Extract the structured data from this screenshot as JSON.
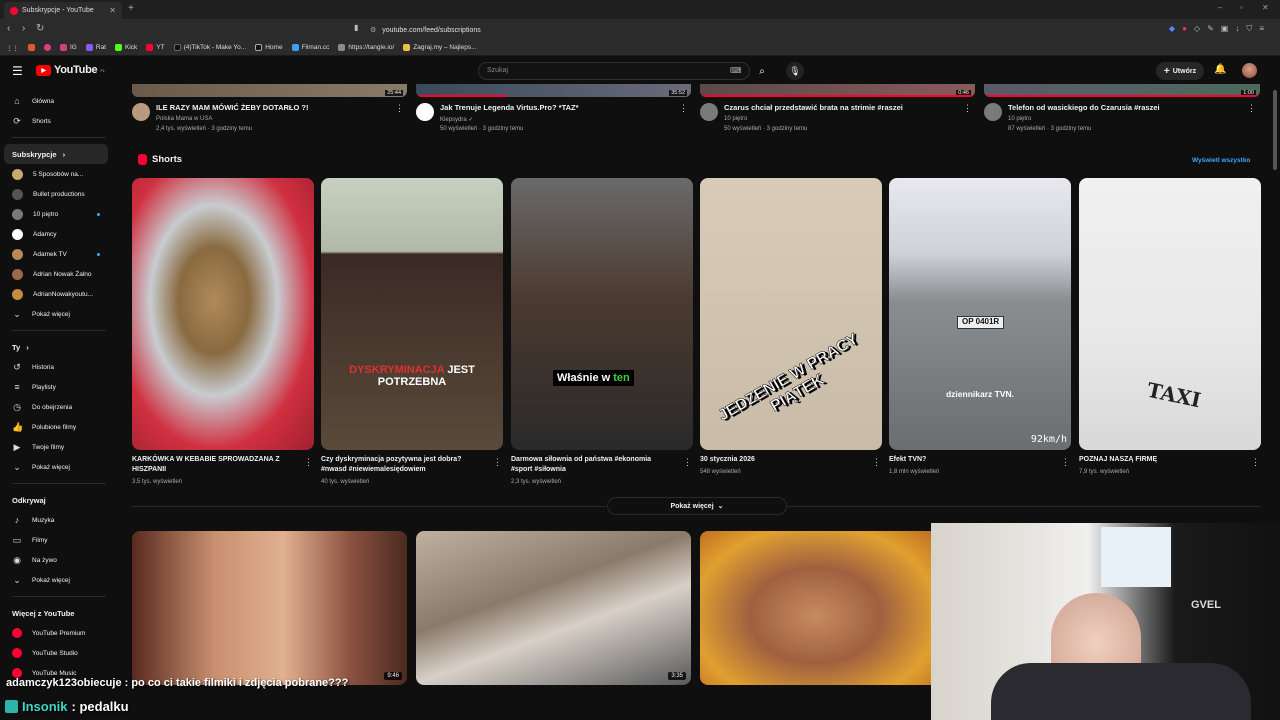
{
  "browser": {
    "tab_title": "Subskrypcje - YouTube",
    "url": "youtube.com/feed/subscriptions",
    "bookmarks": [
      "IG",
      "Rat",
      "Kick",
      "YT",
      "(4)TikTok - Make Yo...",
      "Home",
      "Filman.cc",
      "https://tangle.io/",
      "Zagraj.my – Najleps..."
    ]
  },
  "header": {
    "logo": "YouTube",
    "logo_country": "PL",
    "search_placeholder": "Szukaj",
    "create_label": "Utwórz"
  },
  "sidebar": {
    "main": [
      {
        "label": "Główna",
        "icon": "home-icon",
        "glyph": "⌂"
      },
      {
        "label": "Shorts",
        "icon": "shorts-icon",
        "glyph": "⟳"
      }
    ],
    "subs_title": "Subskrypcje",
    "subs_chevron": "›",
    "subs": [
      {
        "label": "5 Sposobów na...",
        "color": "#c9a770",
        "dot": false
      },
      {
        "label": "Bullet productions",
        "color": "#555555",
        "dot": false
      },
      {
        "label": "10 piętro",
        "color": "#7a7a7a",
        "dot": true
      },
      {
        "label": "Adamcy",
        "color": "#ffffff",
        "dot": false
      },
      {
        "label": "Adamek TV",
        "color": "#b88a5a",
        "dot": true
      },
      {
        "label": "Adrian Nowak Żalno",
        "color": "#9a6a4a",
        "dot": false
      },
      {
        "label": "AdrianNowakyoutu...",
        "color": "#c68a40",
        "dot": false
      }
    ],
    "subs_more": "Pokaż więcej",
    "you_title": "Ty",
    "you_chevron": "›",
    "you": [
      {
        "label": "Historia",
        "icon": "history-icon",
        "glyph": "↺"
      },
      {
        "label": "Playlisty",
        "icon": "playlist-icon",
        "glyph": "≡"
      },
      {
        "label": "Do obejrzenia",
        "icon": "watch-later-icon",
        "glyph": "◷"
      },
      {
        "label": "Polubione filmy",
        "icon": "like-icon",
        "glyph": "👍"
      },
      {
        "label": "Twoje filmy",
        "icon": "your-videos-icon",
        "glyph": "▶"
      },
      {
        "label": "Pokaż więcej",
        "icon": "chevron-down-icon",
        "glyph": "⌄"
      }
    ],
    "explore_title": "Odkrywaj",
    "explore": [
      {
        "label": "Muzyka",
        "icon": "music-icon",
        "glyph": "♪"
      },
      {
        "label": "Filmy",
        "icon": "film-icon",
        "glyph": "▭"
      },
      {
        "label": "Na żywo",
        "icon": "live-icon",
        "glyph": "◉"
      },
      {
        "label": "Pokaż więcej",
        "icon": "chevron-down-icon",
        "glyph": "⌄"
      }
    ],
    "more_title": "Więcej z YouTube",
    "more": [
      {
        "label": "YouTube Premium"
      },
      {
        "label": "YouTube Studio"
      },
      {
        "label": "YouTube Music"
      }
    ]
  },
  "top_videos": [
    {
      "title": "ILE RAZY MAM MÓWIĆ ŻEBY DOTARŁO ?!",
      "channel": "Polska Mama w USA",
      "stats": "2,4 tys. wyświetleń · 3 godziny temu",
      "duration": "25:44",
      "progress": 0
    },
    {
      "title": "Jak Trenuje Legenda Virtus.Pro? *TAZ*",
      "channel": "Klepsydra ✓",
      "stats": "50 wyświetleń · 3 godziny temu",
      "duration": "35:52",
      "progress": 0.33
    },
    {
      "title": "Czarus chciał przedstawić brata na strimie #raszei",
      "channel": "10 piętro",
      "stats": "50 wyświetleń · 3 godziny temu",
      "duration": "0:46",
      "progress": 1
    },
    {
      "title": "Telefon od wasickiego do Czarusia #raszei",
      "channel": "10 piętro",
      "stats": "87 wyświetleń · 3 godziny temu",
      "duration": "1:00",
      "progress": 1
    }
  ],
  "shorts_section": {
    "title": "Shorts",
    "see_all": "Wyświetl wszystko",
    "more_button": "Pokaż więcej",
    "items": [
      {
        "title": "KARKÓWKA W KEBABIE SPROWADZANA Z HISZPANII",
        "views": "3,5 tys. wyświetleń",
        "overlay": ""
      },
      {
        "title": "Czy dyskryminacja pozytywna jest dobra? #nwasd #niewiemalesiędowiem",
        "views": "40 tys. wyświetleń",
        "overlay_a": "DYSKRYMINACJA",
        "overlay_b": "JEST",
        "overlay_c": "POTRZEBNA"
      },
      {
        "title": "Darmowa siłownia od państwa #ekonomia #sport #siłownia",
        "views": "2,3 tys. wyświetleń",
        "overlay_a": "Właśnie w",
        "overlay_b": "ten"
      },
      {
        "title": "30 stycznia 2026",
        "views": "548 wyświetleń",
        "overlay_a": "JEDZENIE W PRACY",
        "overlay_b": "PIĄTEK"
      },
      {
        "title": "Efekt TVN?",
        "views": "1,8 mln wyświetleń",
        "overlay_a": "dziennikarz TVN.",
        "overlay_b": "92km/h",
        "plate": "OP 0401R"
      },
      {
        "title": "POZNAJ NASZĄ FIRMĘ",
        "views": "7,9 tys. wyświetleń",
        "overlay_a": "TAXI"
      }
    ]
  },
  "bottom_videos": [
    {
      "duration": "9:46"
    },
    {
      "duration": "3:35"
    },
    {
      "duration": ""
    }
  ],
  "chat": {
    "line1": "adamczyk123obiecuje : po co ci takie filmiki i zdjęcia pobrane???",
    "nick": "Insonik",
    "message": ": pedalku"
  },
  "webcam": {
    "label": "GVEL"
  }
}
